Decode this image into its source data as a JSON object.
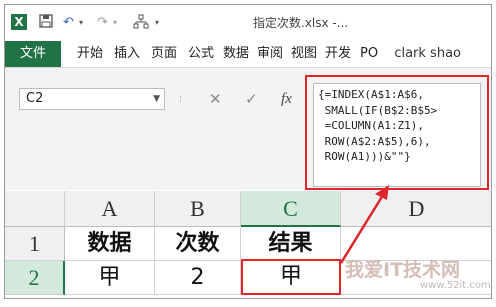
{
  "window": {
    "title": "指定次数.xlsx -...",
    "logo": "X",
    "qa_icons": [
      "save-icon",
      "undo-icon",
      "redo-icon",
      "workbook-structure-icon"
    ]
  },
  "ribbon": {
    "tabs": [
      "文件",
      "开始",
      "插入",
      "页面",
      "公式",
      "数据",
      "审阅",
      "视图",
      "开发",
      "PO"
    ],
    "user": "clark shao",
    "accent_color": "#217346"
  },
  "formula_bar": {
    "name_box": "C2",
    "fx_label": "fx",
    "cancel_icon": "✕",
    "enter_icon": "✓",
    "formula_lines": [
      "{=INDEX(A$1:A$6,",
      " SMALL(IF(B$2:B$5>",
      " =COLUMN(A1:Z1),",
      " ROW(A$2:A$5),6),",
      " ROW(A1)))&\"\"}"
    ]
  },
  "sheet": {
    "columns": [
      "A",
      "B",
      "C",
      "D"
    ],
    "rows": [
      "1",
      "2"
    ],
    "cells": [
      [
        "数据",
        "次数",
        "结果",
        ""
      ],
      [
        "甲",
        "2",
        "甲",
        ""
      ]
    ],
    "highlight_color": "#e0262c"
  },
  "watermark": {
    "text": "我爱IT技术网",
    "url": "www.52it.com"
  }
}
